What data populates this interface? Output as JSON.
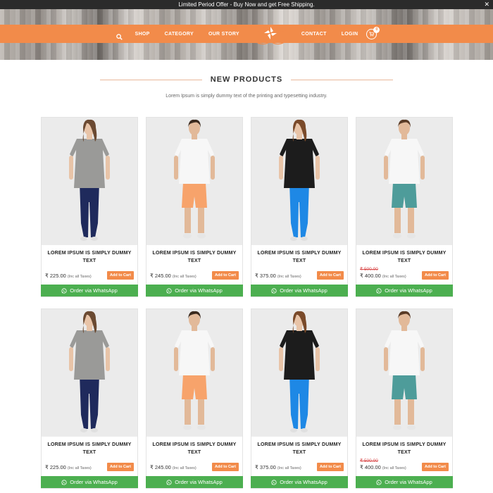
{
  "promo": {
    "text": "Limited Period Offer - Buy Now and get Free Shipping.",
    "close": "✕"
  },
  "nav": {
    "items": [
      "SHOP",
      "CATEGORY",
      "OUR STORY",
      "CONTACT",
      "LOGIN"
    ],
    "cart_count": "0"
  },
  "section": {
    "title": "NEW PRODUCTS",
    "subtitle": "Lorem Ipsum is simply dummy text of the printing and typesetting industry."
  },
  "colors": {
    "accent": "#f28b4a",
    "whatsapp": "#4caf50",
    "topbar": "#2b2b2b"
  },
  "products": [
    {
      "name": "LOREM IPSUM IS SIMPLY DUMMY TEXT",
      "old_price": "",
      "price": "₹ 225.00",
      "tax": "(Inc all Taxes)",
      "add": "Add to Cart",
      "whatsapp": "Order via WhatsApp",
      "model": "woman-grey"
    },
    {
      "name": "LOREM IPSUM IS SIMPLY DUMMY TEXT",
      "old_price": "",
      "price": "₹ 245.00",
      "tax": "(Inc all Taxes)",
      "add": "Add to Cart",
      "whatsapp": "Order via WhatsApp",
      "model": "man-orange"
    },
    {
      "name": "LOREM IPSUM IS SIMPLY DUMMY TEXT",
      "old_price": "",
      "price": "₹ 375.00",
      "tax": "(Inc all Taxes)",
      "add": "Add to Cart",
      "whatsapp": "Order via WhatsApp",
      "model": "woman-black"
    },
    {
      "name": "LOREM IPSUM IS SIMPLY DUMMY TEXT",
      "old_price": "₹ 500.00",
      "price": "₹ 400.00",
      "tax": "(Inc all Taxes)",
      "add": "Add to Cart",
      "whatsapp": "Order via WhatsApp",
      "model": "man-teal"
    },
    {
      "name": "LOREM IPSUM IS SIMPLY DUMMY TEXT",
      "old_price": "",
      "price": "₹ 225.00",
      "tax": "(Inc all Taxes)",
      "add": "Add to Cart",
      "whatsapp": "Order via WhatsApp",
      "model": "woman-grey"
    },
    {
      "name": "LOREM IPSUM IS SIMPLY DUMMY TEXT",
      "old_price": "",
      "price": "₹ 245.00",
      "tax": "(Inc all Taxes)",
      "add": "Add to Cart",
      "whatsapp": "Order via WhatsApp",
      "model": "man-orange"
    },
    {
      "name": "LOREM IPSUM IS SIMPLY DUMMY TEXT",
      "old_price": "",
      "price": "₹ 375.00",
      "tax": "(Inc all Taxes)",
      "add": "Add to Cart",
      "whatsapp": "Order via WhatsApp",
      "model": "woman-black"
    },
    {
      "name": "LOREM IPSUM IS SIMPLY DUMMY TEXT",
      "old_price": "₹ 500.00",
      "price": "₹ 400.00",
      "tax": "(Inc all Taxes)",
      "add": "Add to Cart",
      "whatsapp": "Order via WhatsApp",
      "model": "man-teal"
    }
  ]
}
